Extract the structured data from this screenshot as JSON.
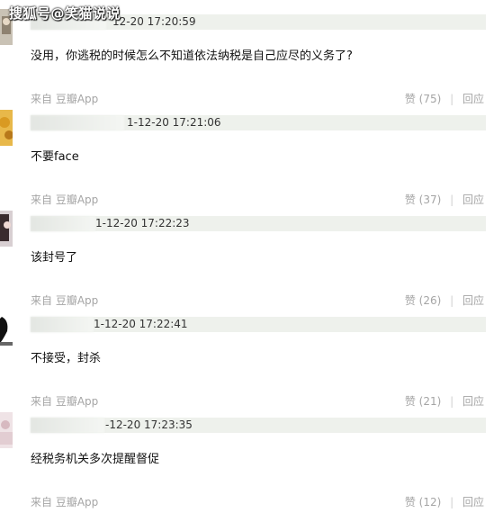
{
  "watermark": "搜狐号@笑猫说说",
  "comments": [
    {
      "timestamp": "2021-12-20 17:20:59",
      "timestamp_visible": "12-20 17:20:59",
      "text": "没用，你逃税的时候怎么不知道依法纳税是自己应尽的义务了?",
      "source": "来自 豆瓣App",
      "like_label": "赞 (75)",
      "reply_label": "回应"
    },
    {
      "timestamp": "2021-12-20 17:21:06",
      "timestamp_visible": "1-12-20 17:21:06",
      "text": "不要face",
      "source": "来自 豆瓣App",
      "like_label": "赞 (37)",
      "reply_label": "回应"
    },
    {
      "timestamp": "2021-12-20 17:22:23",
      "timestamp_visible": "1-12-20 17:22:23",
      "text": "该封号了",
      "source": "来自 豆瓣App",
      "like_label": "赞 (26)",
      "reply_label": "回应"
    },
    {
      "timestamp": "2021-12-20 17:22:41",
      "timestamp_visible": "1-12-20 17:22:41",
      "text": "不接受，封杀",
      "source": "来自 豆瓣App",
      "like_label": "赞 (21)",
      "reply_label": "回应"
    },
    {
      "timestamp": "2021-12-20 17:23:35",
      "timestamp_visible": "-12-20 17:23:35",
      "text": "经税务机关多次提醒督促",
      "source": "来自 豆瓣App",
      "like_label": "赞 (12)",
      "reply_label": "回应"
    }
  ]
}
